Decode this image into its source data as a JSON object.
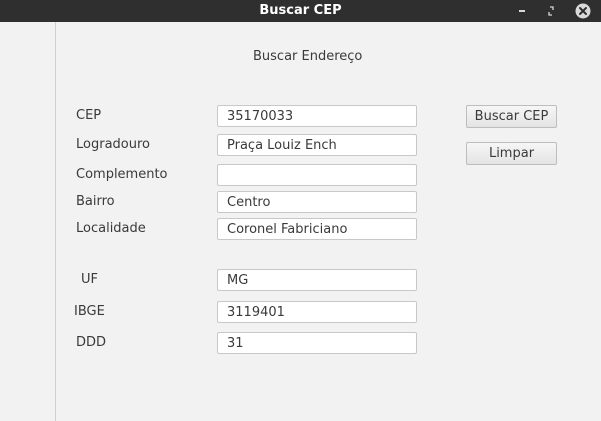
{
  "window": {
    "title": "Buscar CEP"
  },
  "heading": "Buscar Endereço",
  "fields": [
    {
      "label": "CEP",
      "value": "35170033"
    },
    {
      "label": "Logradouro",
      "value": "Praça Louiz Ench"
    },
    {
      "label": "Complemento",
      "value": ""
    },
    {
      "label": "Bairro",
      "value": "Centro"
    },
    {
      "label": "Localidade",
      "value": "Coronel Fabriciano"
    },
    {
      "label": "UF",
      "value": "MG"
    },
    {
      "label": "IBGE",
      "value": "3119401"
    },
    {
      "label": "DDD",
      "value": "31"
    }
  ],
  "buttons": {
    "search": "Buscar CEP",
    "clear": "Limpar"
  }
}
